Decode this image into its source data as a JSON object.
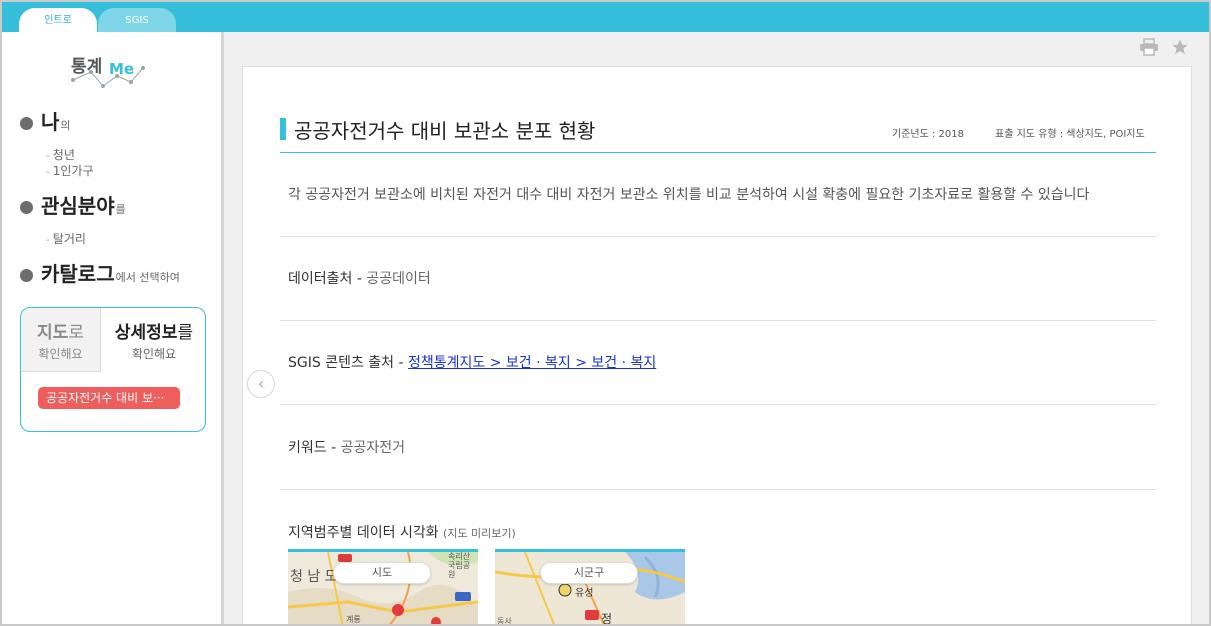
{
  "tabs": [
    {
      "label": "인트로",
      "active": true
    },
    {
      "label": "SGIS",
      "active": false
    }
  ],
  "sidebar": {
    "logo": {
      "ko": "통계",
      "en": "Me"
    },
    "step1": {
      "big": "나",
      "small": "의"
    },
    "step1_items": [
      "청년",
      "1인가구"
    ],
    "step2": {
      "big": "관심분야",
      "small": "를"
    },
    "step2_items": [
      "탈거리"
    ],
    "step3": {
      "big": "카탈로그",
      "small": "에서 선택하여"
    },
    "panel": {
      "map": {
        "big": "지도",
        "big_suffix": "로",
        "small": "확인해요"
      },
      "detail": {
        "big": "상세정보",
        "big_suffix": "를",
        "small": "확인해요"
      },
      "selected_chip": "공공자전거수 대비 보···"
    }
  },
  "toolbar": {
    "print_icon": "printer-icon",
    "favorite_icon": "star-icon"
  },
  "content": {
    "title": "공공자전거수 대비 보관소 분포 현황",
    "base_year": "기준년도 : 2018",
    "map_type": "표출 지도 유형 : 색상지도, POI지도",
    "description": "각 공공자전거 보관소에 비치된 자전거 대수 대비 자전거 보관소 위치를 비교 분석하여 시설 확충에 필요한 기초자료로 활용할 수 있습니다",
    "source": {
      "label": "데이터출처 - ",
      "value": "공공데이터"
    },
    "sgis_source": {
      "label": "SGIS 콘텐츠 출처 - ",
      "link": "정책통계지도 > 보건 · 복지 > 보건 · 복지"
    },
    "keyword": {
      "label": "키워드 - ",
      "value": "공공자전거"
    },
    "visualization": {
      "title": "지역범주별 데이터 시각화 ",
      "hint": "(지도 미리보기)",
      "maps": [
        {
          "label": "시도",
          "places": [
            "청 남 도",
            "계룡",
            "속리산 국립공원"
          ]
        },
        {
          "label": "시군구",
          "places": [
            "유성",
            "정",
            "동사"
          ]
        }
      ]
    }
  },
  "colors": {
    "accent": "#36bfdb",
    "chip": "#ef5d5d",
    "link": "#1a33cc"
  }
}
